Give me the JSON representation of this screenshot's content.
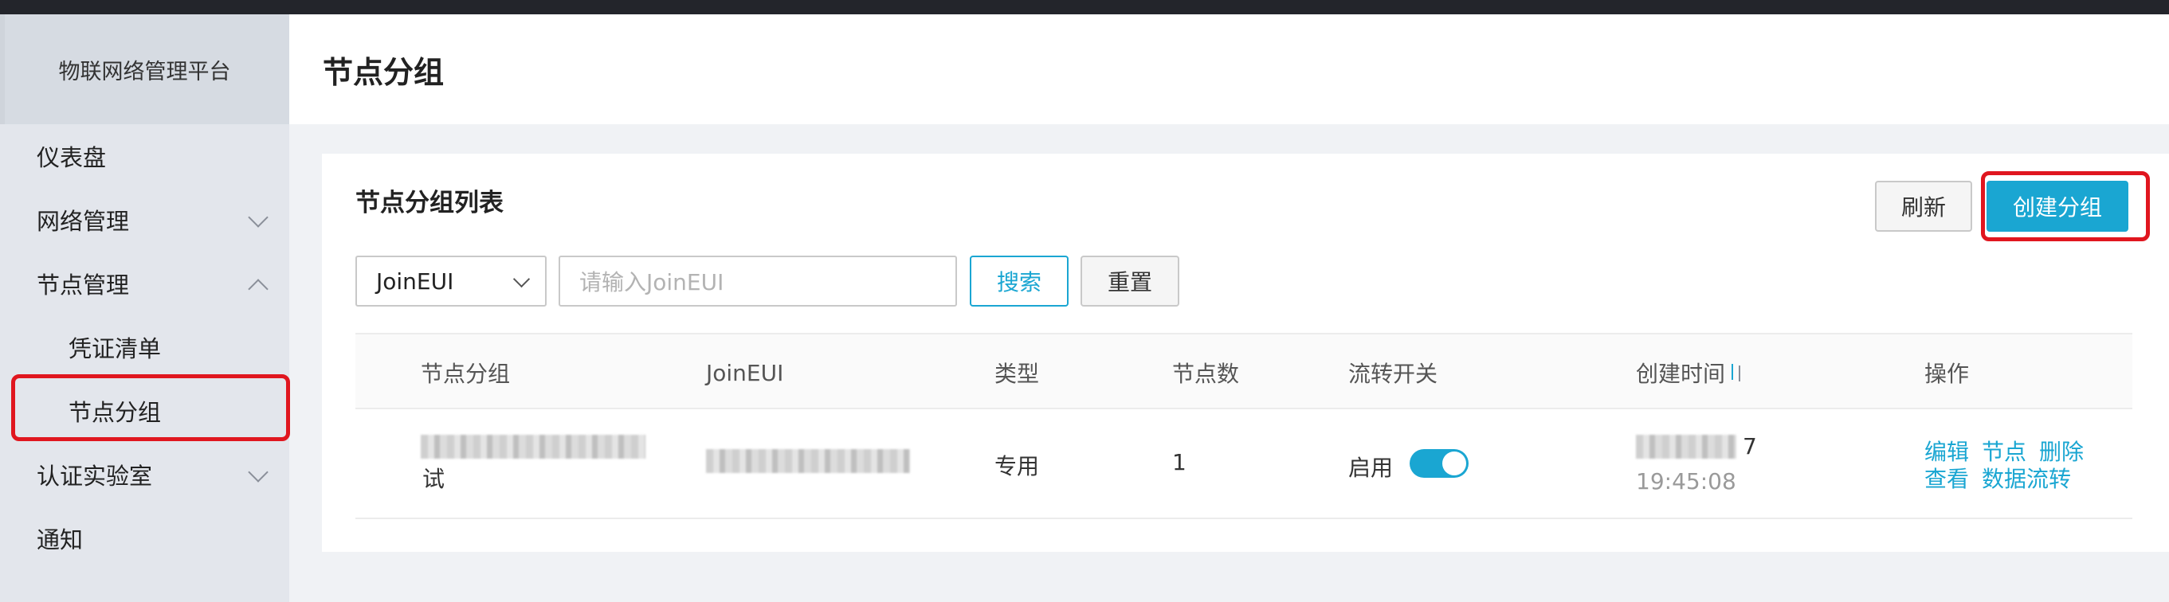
{
  "app": {
    "brand": "物联网络管理平台"
  },
  "sidebar": {
    "items": [
      {
        "label": "仪表盘"
      },
      {
        "label": "网络管理"
      },
      {
        "label": "节点管理"
      },
      {
        "label": "凭证清单"
      },
      {
        "label": "节点分组"
      },
      {
        "label": "认证实验室"
      },
      {
        "label": "通知"
      }
    ]
  },
  "header": {
    "title": "节点分组"
  },
  "card": {
    "title": "节点分组列表",
    "refresh_label": "刷新",
    "create_label": "创建分组"
  },
  "filter": {
    "select_value": "JoinEUI",
    "input_placeholder": "请输入JoinEUI",
    "search_label": "搜索",
    "reset_label": "重置"
  },
  "table": {
    "columns": [
      "节点分组",
      "JoinEUI",
      "类型",
      "节点数",
      "流转开关",
      "创建时间",
      "操作"
    ],
    "rows": [
      {
        "group_name_tail": "试",
        "type": "专用",
        "node_count": "1",
        "flow_switch": "启用",
        "flow_enabled": true,
        "created_tail": "7",
        "created_time": "19:45:08",
        "actions": [
          "编辑",
          "节点",
          "删除",
          "查看",
          "数据流转"
        ]
      }
    ]
  },
  "colors": {
    "accent": "#1aa6d2",
    "highlight": "#e0161f",
    "sidebar_bg": "#e3e6ec"
  }
}
